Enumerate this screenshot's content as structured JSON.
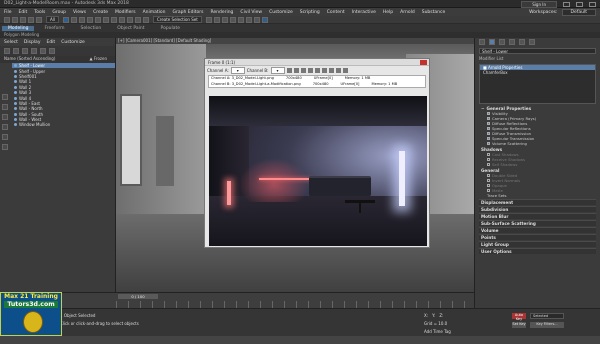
{
  "window": {
    "title": "D02_Light-a-ModelRoom.max - Autodesk 3ds Max 2018",
    "sign_in": "Sign In",
    "workspaces_label": "Workspaces:",
    "workspace": "Default"
  },
  "menu": [
    "File",
    "Edit",
    "Tools",
    "Group",
    "Views",
    "Create",
    "Modifiers",
    "Animation",
    "Graph Editors",
    "Rendering",
    "Civil View",
    "Customize",
    "Scripting",
    "Content",
    "Interactive",
    "Help",
    "Arnold",
    "Substance"
  ],
  "toolbar": {
    "filter": "All",
    "selection_set": "Create Selection Set"
  },
  "ribbon": {
    "tabs": [
      "Modeling",
      "Freeform",
      "Selection",
      "Object Paint",
      "Populate"
    ],
    "active": "Modeling",
    "sub": "Polygon Modeling"
  },
  "explorer": {
    "tabs": [
      "Select",
      "Display",
      "Edit",
      "Customize"
    ],
    "header_name": "Name (Sorted Ascending)",
    "header_frozen": "▲ Frozen",
    "items": [
      {
        "label": "Shelf - Lower",
        "selected": true
      },
      {
        "label": "Shelf - Upper",
        "selected": false
      },
      {
        "label": "Shelf001",
        "selected": false
      },
      {
        "label": "Wall 1",
        "selected": false
      },
      {
        "label": "Wall 2",
        "selected": false
      },
      {
        "label": "Wall 3",
        "selected": false
      },
      {
        "label": "Wall 4",
        "selected": false
      },
      {
        "label": "Wall - East",
        "selected": false
      },
      {
        "label": "Wall - North",
        "selected": false
      },
      {
        "label": "Wall - South",
        "selected": false
      },
      {
        "label": "Wall - West",
        "selected": false
      },
      {
        "label": "Window Mullion",
        "selected": false
      }
    ]
  },
  "viewport": {
    "label": "[+] [Camera001] [Standard] [Default Shading]"
  },
  "framebuffer": {
    "title": "Frame 0 (1:1)",
    "channel_a_label": "Channel A:",
    "channel_b_label": "Channel B:",
    "info_rows": [
      {
        "ch": "Channel A: 3_D02_Model-Light.png",
        "size": "700x480",
        "type": "UFrame[0]",
        "mem": "Memory: 1 MB"
      },
      {
        "ch": "Channel B: 3_D02_Model-Light-a-Modification.png",
        "size": "700x480",
        "type": "UFrame[0]",
        "mem": "Memory: 1 MB"
      }
    ]
  },
  "command_panel": {
    "name_field": "Shelf - Lower",
    "modifier_list": "Modifier List",
    "stack": [
      {
        "label": "■ Arnold Properties",
        "selected": true
      },
      {
        "label": "ChamferBox",
        "selected": false
      }
    ],
    "general_title": "General Properties",
    "general_items": [
      {
        "label": "Visibility",
        "checked": true
      },
      {
        "label": "Camera (Primary Rays)",
        "checked": true
      },
      {
        "label": "Diffuse Reflections",
        "checked": true
      },
      {
        "label": "Specular Reflections",
        "checked": true
      },
      {
        "label": "Diffuse Transmission",
        "checked": true
      },
      {
        "label": "Specular Transmission",
        "checked": true
      },
      {
        "label": "Volume Scattering",
        "checked": true
      }
    ],
    "shadows_title": "Shadows",
    "shadow_items": [
      {
        "label": "Cast Shadows",
        "checked": false
      },
      {
        "label": "Receive Shadows",
        "checked": false
      },
      {
        "label": "Self Shadows",
        "checked": false
      }
    ],
    "general2_title": "General",
    "general2_items": [
      {
        "label": "Double Sided",
        "checked": false
      },
      {
        "label": "Invert Normals",
        "checked": false
      },
      {
        "label": "Opaque",
        "checked": false
      },
      {
        "label": "Matte",
        "checked": false
      }
    ],
    "trace_sets": "Trace Sets",
    "sections": [
      "Displacement",
      "Subdivision",
      "Motion Blur",
      "Sub-Surface Scattering",
      "Volume",
      "Points",
      "Light Group",
      "User Options"
    ]
  },
  "timeline": {
    "slider": "0 / 100"
  },
  "status": {
    "selection": "1 Object Selected",
    "prompt": "Click or click-and-drag to select objects",
    "x": "X:",
    "y": "Y:",
    "z": "Z:",
    "grid": "Grid = 10.0",
    "time_tag": "Add Time Tag",
    "auto_key": "Auto Key",
    "selected": "Selected",
    "set_key": "Set Key",
    "key_filters": "Key Filters..."
  },
  "logo": {
    "line1": "Max 21 Training",
    "line2": "Tutors3d.com"
  }
}
